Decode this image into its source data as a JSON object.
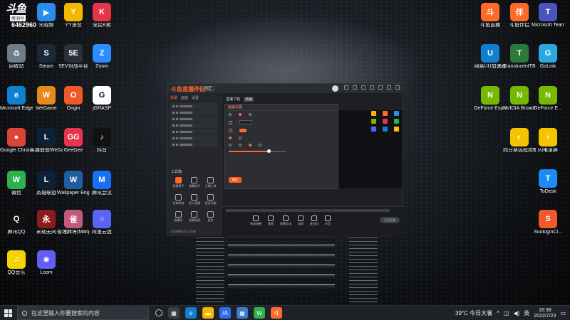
{
  "overlay": {
    "brand": "斗鱼",
    "room_label": "房间号",
    "room_id": "6462960"
  },
  "desktop_icons_left": [
    {
      "label": "讯视频",
      "color": "#2b8cf0",
      "glyph": "▶"
    },
    {
      "label": "YY语音",
      "color": "#f5b800",
      "glyph": "Y"
    },
    {
      "label": "全民K歌",
      "color": "#e8344a",
      "glyph": "K"
    },
    {
      "label": "回收站",
      "color": "#6d7d8c",
      "glyph": "♻"
    },
    {
      "label": "Steam",
      "color": "#1b2838",
      "glyph": "S"
    },
    {
      "label": "5EV对战平台",
      "color": "#2c2f38",
      "glyph": "5E"
    },
    {
      "label": "Zoom",
      "color": "#2d8cff",
      "glyph": "Z"
    },
    {
      "label": "Microsoft Edge",
      "color": "#0f7fcf",
      "glyph": "e"
    },
    {
      "label": "WeGame",
      "color": "#e58b1b",
      "glyph": "W"
    },
    {
      "label": "Origin",
      "color": "#f05a28",
      "glyph": "O"
    },
    {
      "label": "jGRASP",
      "color": "#ffffff",
      "glyph": "G"
    },
    {
      "label": "Google Chrome",
      "color": "#db4437",
      "glyph": "●"
    },
    {
      "label": "英雄联盟WeGame版",
      "color": "#0c2036",
      "glyph": "L"
    },
    {
      "label": "GeeGee",
      "color": "#e5344e",
      "glyph": "GG"
    },
    {
      "label": "抖音",
      "color": "#111111",
      "glyph": "♪"
    },
    {
      "label": "微信",
      "color": "#2bb24c",
      "glyph": "W"
    },
    {
      "label": "英雄联盟",
      "color": "#0c2036",
      "glyph": "L"
    },
    {
      "label": "Wallpaper Engine",
      "color": "#1f5fa0",
      "glyph": "W"
    },
    {
      "label": "腾讯会议",
      "color": "#1b6ff5",
      "glyph": "M"
    },
    {
      "label": "腾讯QQ",
      "color": "#111111",
      "glyph": "Q"
    },
    {
      "label": "永劫无间",
      "color": "#8c1b1b",
      "glyph": "永"
    },
    {
      "label": "雀魂麻将(Mahjong...",
      "color": "#c25a7a",
      "glyph": "雀"
    },
    {
      "label": "阿里云盘",
      "color": "#5b63f5",
      "glyph": "○"
    },
    {
      "label": "QQ音乐",
      "color": "#f5d300",
      "glyph": "♫"
    },
    {
      "label": "Loom",
      "color": "#625df5",
      "glyph": "✺"
    }
  ],
  "desktop_icons_right": [
    {
      "label": "斗鱼直播",
      "color": "#ff6a2a",
      "glyph": "斗"
    },
    {
      "label": "斗鱼伴侣",
      "color": "#ff6a2a",
      "glyph": "伴"
    },
    {
      "label": "Microsoft Teams",
      "color": "#4b53bc",
      "glyph": "T"
    },
    {
      "label": "网易UU加速器",
      "color": "#0f7fcf",
      "glyph": "U"
    },
    {
      "label": "TranslucentTB",
      "color": "#2b7a3c",
      "glyph": "T"
    },
    {
      "label": "GoLink",
      "color": "#2aa8e0",
      "glyph": "G"
    },
    {
      "label": "GeForce Experience",
      "color": "#76b900",
      "glyph": "N"
    },
    {
      "label": "NVIDIA Broadcast",
      "color": "#76b900",
      "glyph": "N"
    },
    {
      "label": "GeForce E...",
      "color": "#76b900",
      "glyph": "N"
    },
    {
      "label": "向日葵远程控制",
      "color": "#f5c400",
      "glyph": "◐"
    },
    {
      "label": "闪电录屏",
      "color": "#f5c400",
      "glyph": "⚡"
    },
    {
      "label": "ToDesk",
      "color": "#1b8cf5",
      "glyph": "T"
    },
    {
      "label": "SunloginCl...",
      "color": "#f05a28",
      "glyph": "S"
    }
  ],
  "app": {
    "title": "斗鱼直播伴侣",
    "mode": "横屏",
    "tab_label": "直播下载",
    "tab_tag": "新版",
    "left_tabs": [
      "场景",
      "画面",
      "设置"
    ],
    "tools_title": "工具箱",
    "tools": [
      "直播帮手",
      "弹幕助手",
      "主播工具",
      "礼物特效",
      "录入直播",
      "更多功能",
      "直播间",
      "直播录屏",
      "更多"
    ],
    "footer": "斗鱼直播伴侣 已连接",
    "dialog": {
      "title": "画面设置",
      "ok": "确定"
    },
    "bottom_tools": [
      "画面调整",
      "美颜",
      "直播互动",
      "录屏",
      "麦克风",
      "声音"
    ],
    "start_live": "开始直播"
  },
  "taskbar": {
    "search_placeholder": "在这里输入你要搜索的内容",
    "weather": "39°C 今日大暑",
    "ime": "英",
    "time": "16:38",
    "date": "2022/7/23"
  }
}
